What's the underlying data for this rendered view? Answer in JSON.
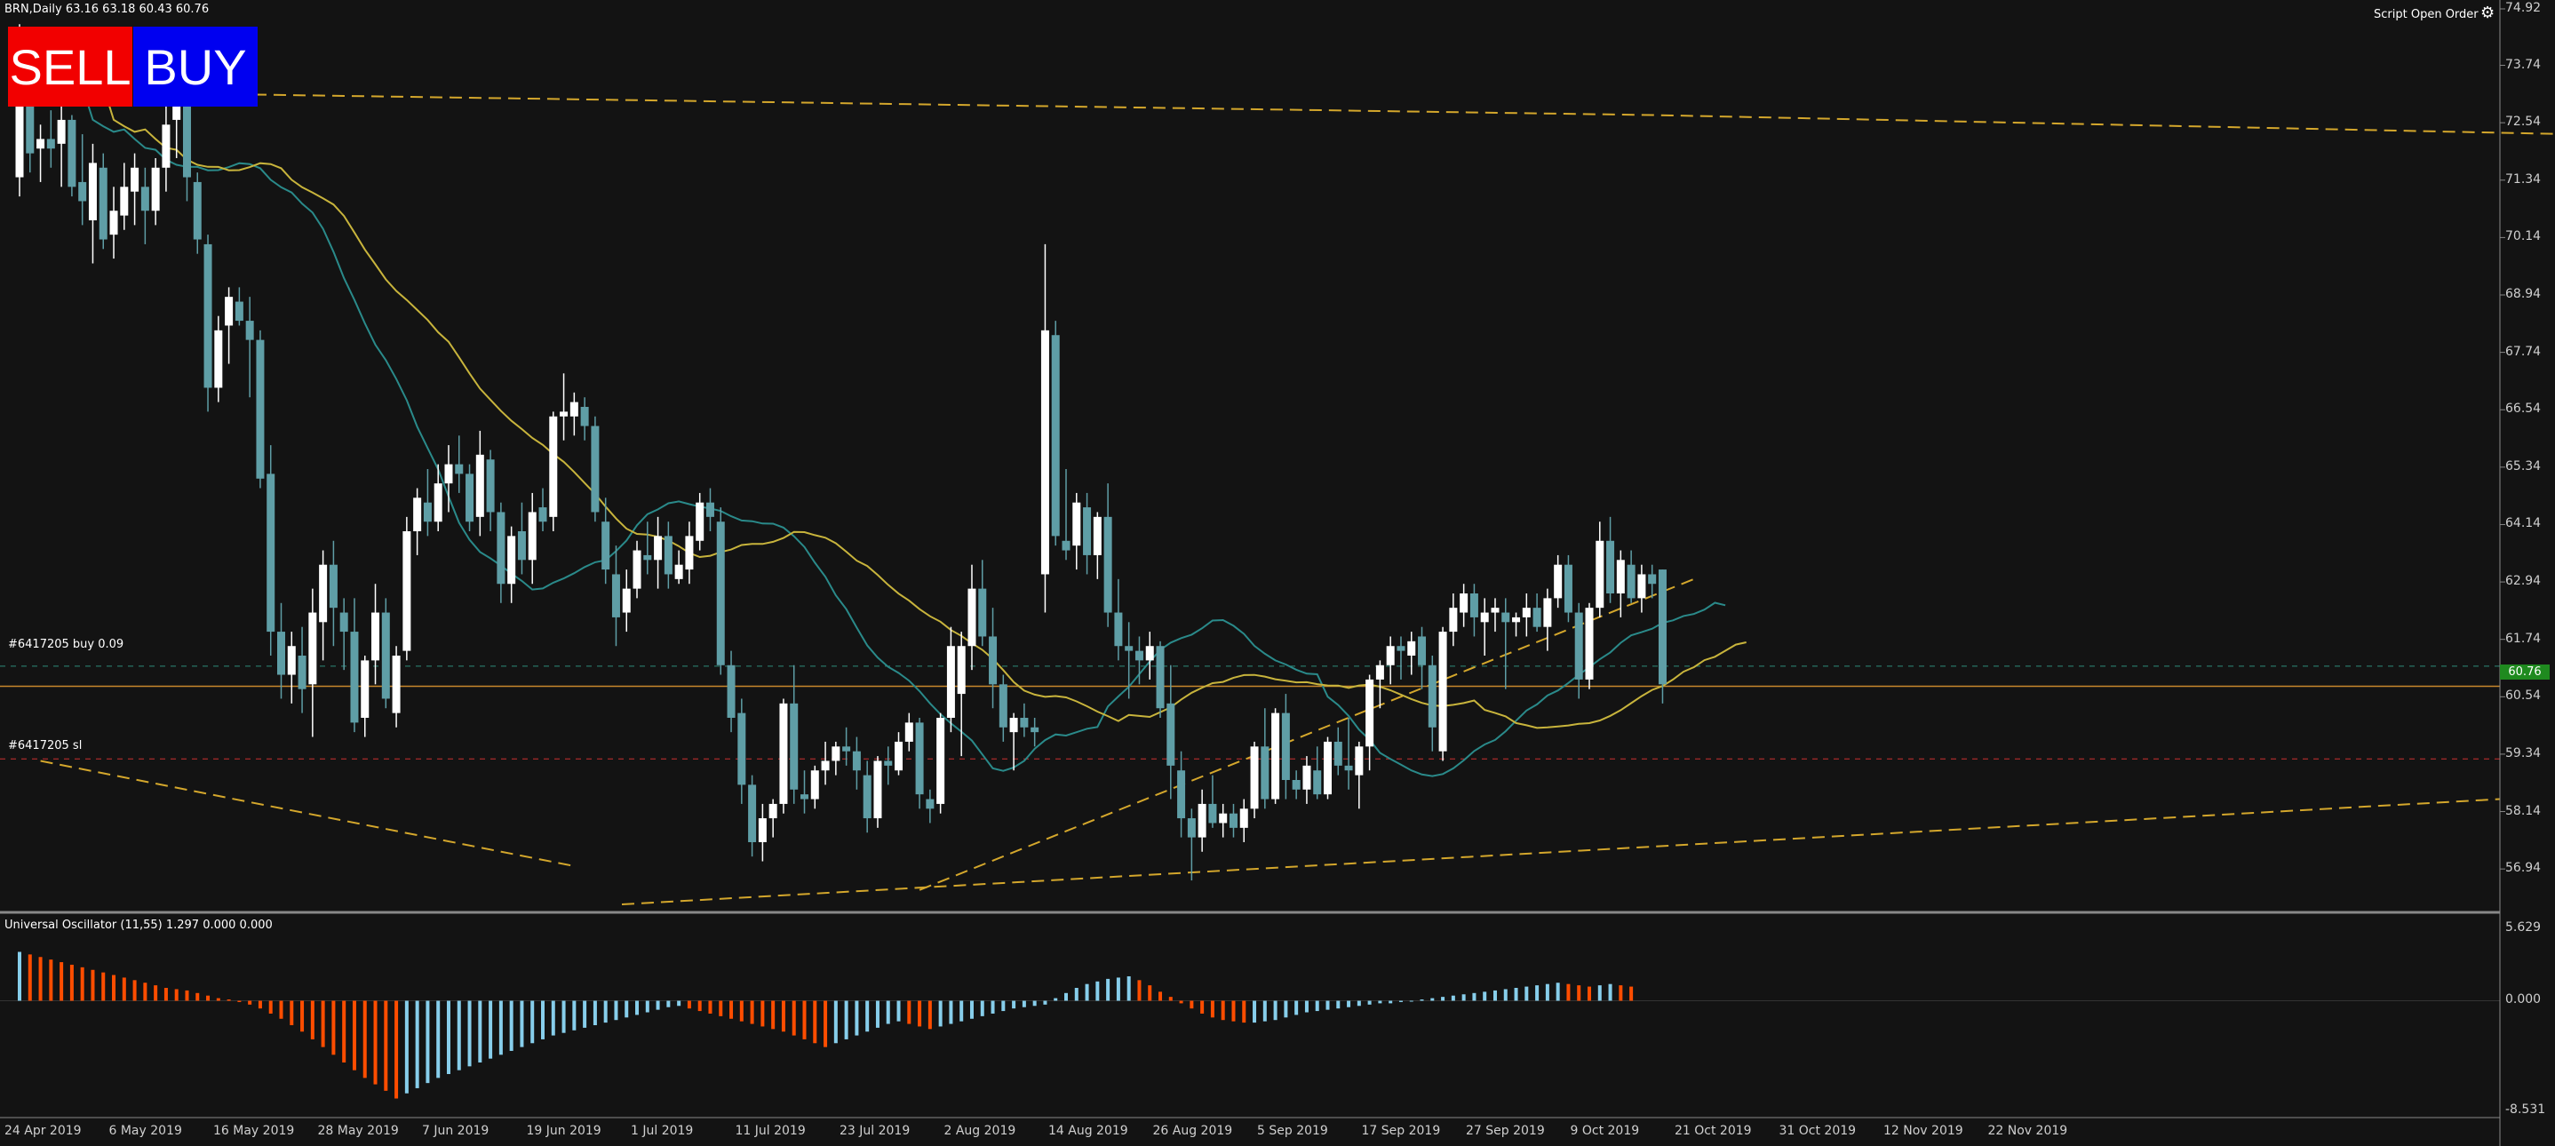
{
  "header": {
    "symbol_info": "BRN,Daily  63.16 63.18 60.43 60.76",
    "script_label": "Script Open Order"
  },
  "buttons": {
    "sell": "SELL",
    "buy": "BUY"
  },
  "order_lines": {
    "buy": "#6417205 buy 0.09",
    "sl": "#6417205 sl"
  },
  "oscillator": {
    "label": "Universal Oscillator (11,55) 1.297 0.000 0.000"
  },
  "colors": {
    "background": "#131313",
    "bull_candle": "#ffffff",
    "bear_candle": "#5f9ea6",
    "trend_line": "#d4a72c",
    "order_buy": "#2e8b7a",
    "order_sl": "#cc3333",
    "price_line": "#c8882c",
    "osc_positive": "#87ceeb",
    "osc_negative": "#ff4d00"
  },
  "chart_data": {
    "type": "candlestick",
    "title": "",
    "symbol": "BRN",
    "timeframe": "Daily",
    "ylim": [
      56.2,
      74.92
    ],
    "y_ticks": [
      "74.92",
      "73.74",
      "72.54",
      "71.34",
      "70.14",
      "68.94",
      "67.74",
      "66.54",
      "65.34",
      "64.14",
      "62.94",
      "61.74",
      "60.54",
      "59.34",
      "58.14",
      "56.94"
    ],
    "current_price": "60.76",
    "order_buy_price": 61.18,
    "order_sl_price": 59.24,
    "x_ticks": [
      "24 Apr 2019",
      "6 May 2019",
      "16 May 2019",
      "28 May 2019",
      "7 Jun 2019",
      "19 Jun 2019",
      "1 Jul 2019",
      "11 Jul 2019",
      "23 Jul 2019",
      "2 Aug 2019",
      "14 Aug 2019",
      "26 Aug 2019",
      "5 Sep 2019",
      "17 Sep 2019",
      "27 Sep 2019",
      "9 Oct 2019",
      "21 Oct 2019",
      "31 Oct 2019",
      "12 Nov 2019",
      "22 Nov 2019"
    ],
    "candles": [
      [
        71.4,
        74.6,
        71.0,
        73.3
      ],
      [
        73.0,
        73.3,
        71.5,
        71.9
      ],
      [
        72.0,
        72.5,
        71.3,
        72.2
      ],
      [
        72.2,
        72.8,
        71.6,
        72.0
      ],
      [
        72.1,
        73.0,
        71.2,
        72.6
      ],
      [
        72.6,
        72.7,
        71.0,
        71.2
      ],
      [
        71.3,
        72.3,
        70.4,
        70.9
      ],
      [
        70.5,
        72.1,
        69.6,
        71.7
      ],
      [
        71.6,
        71.9,
        69.9,
        70.1
      ],
      [
        70.2,
        71.2,
        69.7,
        70.7
      ],
      [
        70.6,
        71.7,
        70.3,
        71.2
      ],
      [
        71.1,
        71.9,
        70.4,
        71.6
      ],
      [
        71.2,
        71.6,
        70.0,
        70.7
      ],
      [
        70.7,
        71.8,
        70.4,
        71.6
      ],
      [
        71.6,
        73.4,
        71.1,
        72.5
      ],
      [
        72.6,
        73.2,
        71.8,
        72.9
      ],
      [
        73.0,
        73.1,
        70.9,
        71.4
      ],
      [
        71.3,
        71.5,
        69.8,
        70.1
      ],
      [
        70.0,
        70.2,
        66.5,
        67.0
      ],
      [
        67.0,
        68.5,
        66.7,
        68.2
      ],
      [
        68.3,
        69.1,
        67.5,
        68.9
      ],
      [
        68.8,
        69.1,
        68.3,
        68.4
      ],
      [
        68.4,
        68.9,
        66.8,
        68.0
      ],
      [
        68.0,
        68.2,
        64.9,
        65.1
      ],
      [
        65.2,
        65.8,
        61.4,
        61.9
      ],
      [
        61.9,
        62.5,
        60.5,
        61.0
      ],
      [
        61.0,
        61.9,
        60.4,
        61.6
      ],
      [
        61.4,
        62.0,
        60.2,
        60.7
      ],
      [
        60.8,
        62.8,
        59.7,
        62.3
      ],
      [
        62.1,
        63.6,
        61.3,
        63.3
      ],
      [
        63.3,
        63.8,
        61.6,
        62.4
      ],
      [
        62.3,
        62.6,
        61.1,
        61.9
      ],
      [
        61.9,
        62.6,
        59.8,
        60.0
      ],
      [
        60.1,
        61.4,
        59.7,
        61.3
      ],
      [
        61.3,
        62.9,
        60.8,
        62.3
      ],
      [
        62.3,
        62.6,
        60.3,
        60.5
      ],
      [
        60.2,
        61.6,
        59.9,
        61.4
      ],
      [
        61.5,
        64.3,
        61.3,
        64.0
      ],
      [
        64.0,
        64.9,
        63.5,
        64.7
      ],
      [
        64.6,
        65.3,
        63.9,
        64.2
      ],
      [
        64.2,
        65.4,
        64.0,
        65.0
      ],
      [
        65.0,
        65.8,
        64.4,
        65.4
      ],
      [
        65.4,
        66.0,
        64.8,
        65.2
      ],
      [
        65.2,
        65.4,
        64.0,
        64.2
      ],
      [
        64.3,
        66.1,
        63.9,
        65.6
      ],
      [
        65.5,
        65.7,
        64.0,
        64.4
      ],
      [
        64.4,
        64.6,
        62.5,
        62.9
      ],
      [
        62.9,
        64.1,
        62.5,
        63.9
      ],
      [
        64.0,
        64.6,
        63.1,
        63.4
      ],
      [
        63.4,
        64.8,
        62.9,
        64.4
      ],
      [
        64.5,
        64.9,
        64.0,
        64.2
      ],
      [
        64.3,
        66.5,
        64.0,
        66.4
      ],
      [
        66.4,
        67.3,
        65.9,
        66.5
      ],
      [
        66.4,
        66.9,
        66.0,
        66.7
      ],
      [
        66.6,
        66.8,
        65.9,
        66.2
      ],
      [
        66.2,
        66.4,
        64.2,
        64.4
      ],
      [
        64.2,
        64.7,
        62.9,
        63.2
      ],
      [
        63.1,
        63.7,
        61.6,
        62.2
      ],
      [
        62.3,
        63.2,
        61.9,
        62.8
      ],
      [
        62.8,
        63.8,
        62.6,
        63.6
      ],
      [
        63.5,
        64.2,
        63.1,
        63.4
      ],
      [
        63.4,
        64.3,
        62.8,
        63.9
      ],
      [
        63.9,
        64.2,
        62.8,
        63.1
      ],
      [
        63.0,
        63.6,
        62.9,
        63.3
      ],
      [
        63.2,
        64.2,
        62.9,
        63.9
      ],
      [
        63.8,
        64.8,
        63.6,
        64.6
      ],
      [
        64.6,
        64.9,
        64.0,
        64.3
      ],
      [
        64.2,
        64.5,
        61.0,
        61.2
      ],
      [
        61.2,
        61.5,
        59.8,
        60.1
      ],
      [
        60.2,
        60.5,
        58.3,
        58.7
      ],
      [
        58.7,
        58.9,
        57.2,
        57.5
      ],
      [
        57.5,
        58.3,
        57.1,
        58.0
      ],
      [
        58.0,
        58.4,
        57.6,
        58.3
      ],
      [
        58.3,
        60.5,
        58.1,
        60.4
      ],
      [
        60.4,
        61.2,
        58.3,
        58.6
      ],
      [
        58.5,
        59.0,
        58.1,
        58.4
      ],
      [
        58.4,
        59.1,
        58.2,
        59.0
      ],
      [
        59.0,
        59.6,
        58.7,
        59.2
      ],
      [
        59.2,
        59.6,
        58.9,
        59.5
      ],
      [
        59.5,
        59.9,
        59.1,
        59.4
      ],
      [
        59.4,
        59.7,
        58.6,
        59.0
      ],
      [
        58.9,
        59.2,
        57.7,
        58.0
      ],
      [
        58.0,
        59.3,
        57.8,
        59.2
      ],
      [
        59.2,
        59.5,
        58.7,
        59.1
      ],
      [
        59.0,
        59.8,
        58.9,
        59.6
      ],
      [
        59.6,
        60.2,
        59.4,
        60.0
      ],
      [
        60.0,
        60.1,
        58.2,
        58.5
      ],
      [
        58.4,
        58.6,
        57.9,
        58.2
      ],
      [
        58.3,
        60.2,
        58.1,
        60.1
      ],
      [
        60.1,
        62.0,
        59.8,
        61.6
      ],
      [
        60.6,
        61.9,
        59.3,
        61.6
      ],
      [
        61.6,
        63.3,
        61.1,
        62.8
      ],
      [
        62.8,
        63.4,
        61.6,
        61.8
      ],
      [
        61.8,
        62.4,
        60.3,
        60.8
      ],
      [
        60.8,
        61.0,
        59.6,
        59.9
      ],
      [
        59.8,
        60.2,
        59.0,
        60.1
      ],
      [
        60.1,
        60.4,
        59.7,
        59.9
      ],
      [
        59.9,
        60.1,
        59.5,
        59.8
      ],
      [
        63.1,
        70.0,
        62.3,
        68.2
      ],
      [
        68.1,
        68.4,
        63.7,
        63.9
      ],
      [
        63.8,
        65.3,
        63.4,
        63.6
      ],
      [
        63.7,
        64.8,
        63.2,
        64.6
      ],
      [
        64.5,
        64.8,
        63.1,
        63.5
      ],
      [
        63.5,
        64.4,
        63.0,
        64.3
      ],
      [
        64.3,
        65.0,
        62.0,
        62.3
      ],
      [
        62.3,
        63.0,
        61.3,
        61.6
      ],
      [
        61.6,
        62.1,
        60.5,
        61.5
      ],
      [
        61.5,
        61.8,
        60.8,
        61.3
      ],
      [
        61.3,
        61.9,
        60.9,
        61.6
      ],
      [
        61.6,
        61.7,
        60.1,
        60.3
      ],
      [
        60.4,
        61.2,
        58.4,
        59.1
      ],
      [
        59.0,
        59.4,
        57.6,
        58.0
      ],
      [
        58.0,
        58.2,
        56.7,
        57.6
      ],
      [
        57.6,
        58.6,
        57.3,
        58.3
      ],
      [
        58.3,
        58.9,
        57.8,
        57.9
      ],
      [
        57.9,
        58.3,
        57.6,
        58.1
      ],
      [
        58.1,
        58.3,
        57.6,
        57.8
      ],
      [
        57.8,
        58.4,
        57.5,
        58.2
      ],
      [
        58.2,
        59.6,
        58.0,
        59.5
      ],
      [
        59.5,
        60.3,
        58.2,
        58.4
      ],
      [
        58.4,
        60.3,
        58.3,
        60.2
      ],
      [
        60.2,
        60.6,
        58.4,
        58.8
      ],
      [
        58.8,
        59.0,
        58.4,
        58.6
      ],
      [
        58.6,
        59.3,
        58.3,
        59.1
      ],
      [
        59.0,
        59.5,
        58.4,
        58.5
      ],
      [
        58.5,
        59.7,
        58.4,
        59.6
      ],
      [
        59.6,
        59.9,
        58.9,
        59.1
      ],
      [
        59.1,
        60.1,
        58.6,
        59.0
      ],
      [
        58.9,
        59.6,
        58.2,
        59.5
      ],
      [
        59.5,
        61.0,
        59.0,
        60.9
      ],
      [
        60.9,
        61.3,
        60.3,
        61.2
      ],
      [
        61.2,
        61.8,
        60.8,
        61.6
      ],
      [
        61.6,
        61.8,
        60.9,
        61.5
      ],
      [
        61.4,
        61.9,
        61.0,
        61.7
      ],
      [
        61.8,
        62.0,
        60.7,
        61.2
      ],
      [
        61.2,
        61.4,
        59.4,
        59.9
      ],
      [
        59.4,
        62.0,
        59.2,
        61.9
      ],
      [
        61.9,
        62.7,
        61.6,
        62.4
      ],
      [
        62.3,
        62.9,
        62.0,
        62.7
      ],
      [
        62.7,
        62.9,
        61.8,
        62.2
      ],
      [
        62.1,
        62.6,
        61.4,
        62.3
      ],
      [
        62.3,
        62.6,
        61.9,
        62.4
      ],
      [
        62.3,
        62.6,
        60.7,
        62.1
      ],
      [
        62.1,
        62.3,
        61.8,
        62.2
      ],
      [
        62.2,
        62.7,
        61.8,
        62.4
      ],
      [
        62.4,
        62.7,
        61.9,
        62.0
      ],
      [
        62.0,
        62.8,
        61.5,
        62.6
      ],
      [
        62.6,
        63.5,
        62.4,
        63.3
      ],
      [
        63.3,
        63.5,
        62.1,
        62.3
      ],
      [
        62.3,
        62.5,
        60.5,
        60.9
      ],
      [
        60.9,
        62.5,
        60.7,
        62.4
      ],
      [
        62.4,
        64.2,
        62.2,
        63.8
      ],
      [
        63.8,
        64.3,
        62.5,
        62.7
      ],
      [
        62.7,
        63.6,
        62.2,
        63.4
      ],
      [
        63.3,
        63.6,
        62.5,
        62.6
      ],
      [
        62.6,
        63.3,
        62.3,
        63.1
      ],
      [
        63.1,
        63.3,
        62.6,
        62.9
      ],
      [
        63.2,
        63.2,
        60.4,
        60.8
      ]
    ],
    "oscillator": {
      "ylim": [
        -8.531,
        5.629
      ],
      "y_ticks": [
        "5.629",
        "0.000",
        "-8.531"
      ],
      "values": [
        3.8,
        3.6,
        3.4,
        3.2,
        3.0,
        2.8,
        2.6,
        2.4,
        2.2,
        2.0,
        1.8,
        1.6,
        1.4,
        1.2,
        1.0,
        0.9,
        0.8,
        0.6,
        0.4,
        0.2,
        0.1,
        -0.1,
        -0.3,
        -0.6,
        -1.0,
        -1.4,
        -1.9,
        -2.4,
        -3.0,
        -3.6,
        -4.2,
        -4.8,
        -5.4,
        -6.0,
        -6.5,
        -7.0,
        -7.6,
        -7.2,
        -6.8,
        -6.4,
        -6.0,
        -5.7,
        -5.4,
        -5.1,
        -4.8,
        -4.5,
        -4.2,
        -3.9,
        -3.6,
        -3.3,
        -3.0,
        -2.7,
        -2.5,
        -2.3,
        -2.1,
        -1.9,
        -1.7,
        -1.5,
        -1.3,
        -1.1,
        -0.9,
        -0.7,
        -0.5,
        -0.4,
        -0.6,
        -0.8,
        -1.0,
        -1.2,
        -1.4,
        -1.6,
        -1.8,
        -2.0,
        -2.2,
        -2.4,
        -2.7,
        -3.0,
        -3.3,
        -3.6,
        -3.3,
        -3.0,
        -2.7,
        -2.4,
        -2.1,
        -1.8,
        -1.6,
        -1.8,
        -2.0,
        -2.2,
        -2.0,
        -1.8,
        -1.6,
        -1.4,
        -1.2,
        -1.0,
        -0.8,
        -0.6,
        -0.5,
        -0.4,
        -0.3,
        0.2,
        0.6,
        1.0,
        1.3,
        1.5,
        1.7,
        1.8,
        1.9,
        1.6,
        1.2,
        0.7,
        0.3,
        -0.2,
        -0.6,
        -1.0,
        -1.3,
        -1.5,
        -1.6,
        -1.7,
        -1.7,
        -1.6,
        -1.5,
        -1.3,
        -1.1,
        -0.9,
        -0.8,
        -0.7,
        -0.6,
        -0.5,
        -0.4,
        -0.3,
        -0.2,
        -0.2,
        -0.1,
        0.0,
        0.1,
        0.2,
        0.3,
        0.4,
        0.5,
        0.6,
        0.7,
        0.8,
        0.9,
        1.0,
        1.1,
        1.2,
        1.3,
        1.4,
        1.3,
        1.2,
        1.1,
        1.2,
        1.3,
        1.2,
        1.1
      ]
    }
  }
}
